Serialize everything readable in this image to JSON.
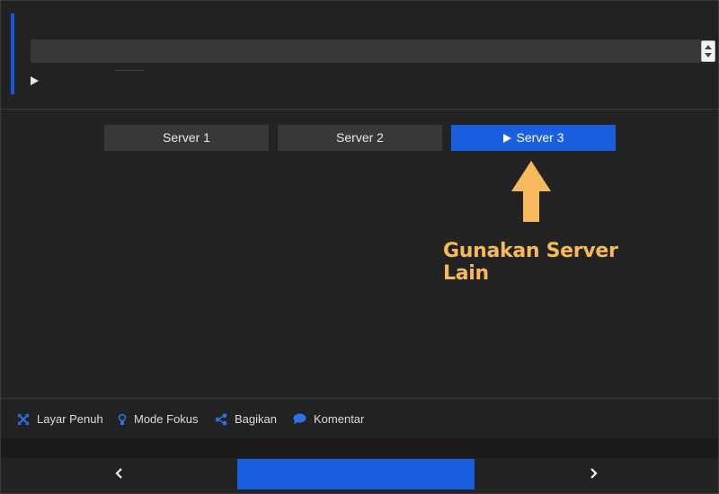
{
  "servers": [
    {
      "label": "Server 1",
      "active": false
    },
    {
      "label": "Server 2",
      "active": false
    },
    {
      "label": "Server 3",
      "active": true
    }
  ],
  "annotation": {
    "text": "Gunakan Server Lain",
    "color": "#f8b95c"
  },
  "actions": [
    {
      "label": "Layar Penuh",
      "icon": "fullscreen-icon"
    },
    {
      "label": "Mode Fokus",
      "icon": "lightbulb-icon"
    },
    {
      "label": "Bagikan",
      "icon": "share-icon"
    },
    {
      "label": "Komentar",
      "icon": "comment-icon"
    }
  ],
  "nav": {
    "prev_icon": "chevron-left-icon",
    "next_icon": "chevron-right-icon"
  },
  "colors": {
    "accent": "#1a5fe0",
    "background": "#232323",
    "button": "#383838"
  }
}
